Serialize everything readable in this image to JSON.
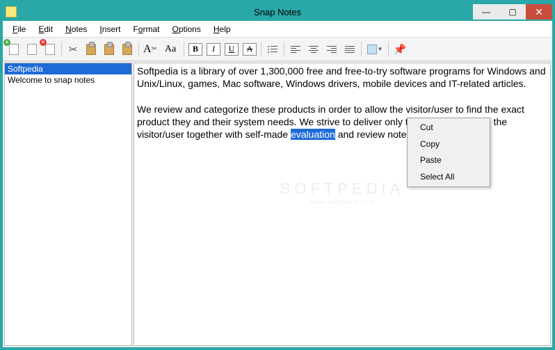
{
  "window": {
    "title": "Snap Notes"
  },
  "menubar": [
    {
      "key": "F",
      "rest": "ile"
    },
    {
      "key": "E",
      "rest": "dit"
    },
    {
      "key": "N",
      "rest": "otes"
    },
    {
      "key": "I",
      "rest": "nsert"
    },
    {
      "key": "",
      "rest": "Format",
      "pre": "F",
      "mid": "o",
      "post": "rmat"
    },
    {
      "key": "O",
      "rest": "ptions"
    },
    {
      "key": "H",
      "rest": "elp"
    }
  ],
  "menu_labels": {
    "file": "File",
    "edit": "Edit",
    "notes": "Notes",
    "insert": "Insert",
    "format": "Format",
    "options": "Options",
    "help": "Help"
  },
  "fmt": {
    "bold": "B",
    "italic": "I",
    "underline": "U",
    "strike": "A",
    "font": "Aa",
    "font2": "A"
  },
  "sidebar": {
    "items": [
      {
        "label": "Softpedia",
        "selected": true
      },
      {
        "label": "Welcome to snap notes",
        "selected": false
      }
    ]
  },
  "editor": {
    "p1": "Softpedia is a library of over 1,300,000 free and free-to-try software programs for Windows and Unix/Linux, games, Mac software, Windows drivers, mobile devices and IT-related articles.",
    "p2_before": "We review and categorize these products in order to allow the visitor/user to find the exact product they and their system needs. We strive to deliver only the best products to the visitor/user together with self-made ",
    "p2_selected": "evaluation",
    "p2_after": " and review notes."
  },
  "context_menu": {
    "items": [
      "Cut",
      "Copy",
      "Paste",
      "Select All"
    ]
  },
  "watermark": {
    "main": "SOFTPEDIA",
    "sub": "www.softpedia.com"
  }
}
